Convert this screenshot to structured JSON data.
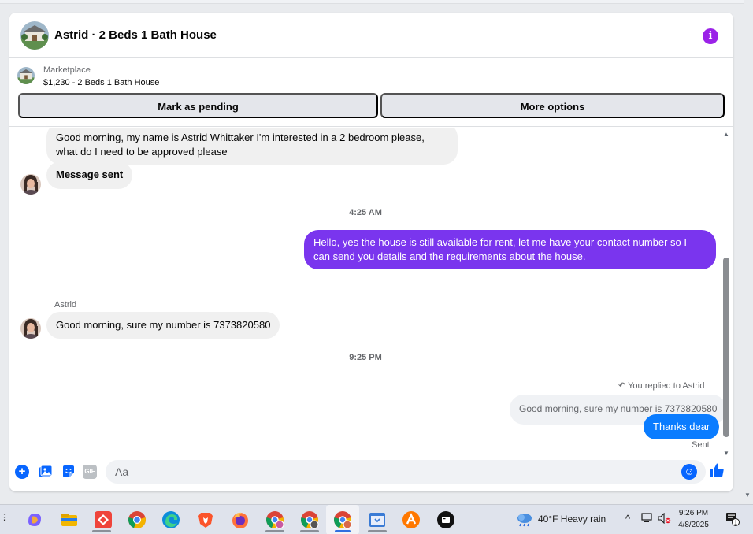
{
  "chat": {
    "title": "Astrid · 2 Beds 1 Bath House",
    "listing": {
      "label": "Marketplace",
      "price_title": "$1,230 - 2 Beds 1 Bath House"
    },
    "buttons": {
      "pending": "Mark as pending",
      "more": "More options"
    }
  },
  "messages": {
    "m1_line1": "Good morning, my name is Astrid Whittaker I'm interested in a 2 bedroom please,",
    "m1_line2": "what do I need to be approved please",
    "m2": "Message sent",
    "ts1": "4:25 AM",
    "m3_line1": "Hello, yes the house is still available for rent, let me have your contact number so I",
    "m3_line2": "can send you details and the requirements about the house.",
    "sender": "Astrid",
    "m4": "Good morning, sure my number is 7373820580",
    "ts2": "9:25 PM",
    "reply_indicator": "You replied to Astrid",
    "quoted": "Good morning, sure my number is 7373820580",
    "m5": "Thanks dear",
    "status": "Sent"
  },
  "composer": {
    "placeholder": "Aa",
    "gif_label": "GIF"
  },
  "taskbar": {
    "weather": "40°F  Heavy rain",
    "time": "9:26 PM",
    "date": "4/8/2025",
    "notif_count": "1"
  },
  "colors": {
    "accent_purple": "#7a35ee",
    "accent_blue": "#0a7cff",
    "info_purple": "#9b22e8"
  }
}
